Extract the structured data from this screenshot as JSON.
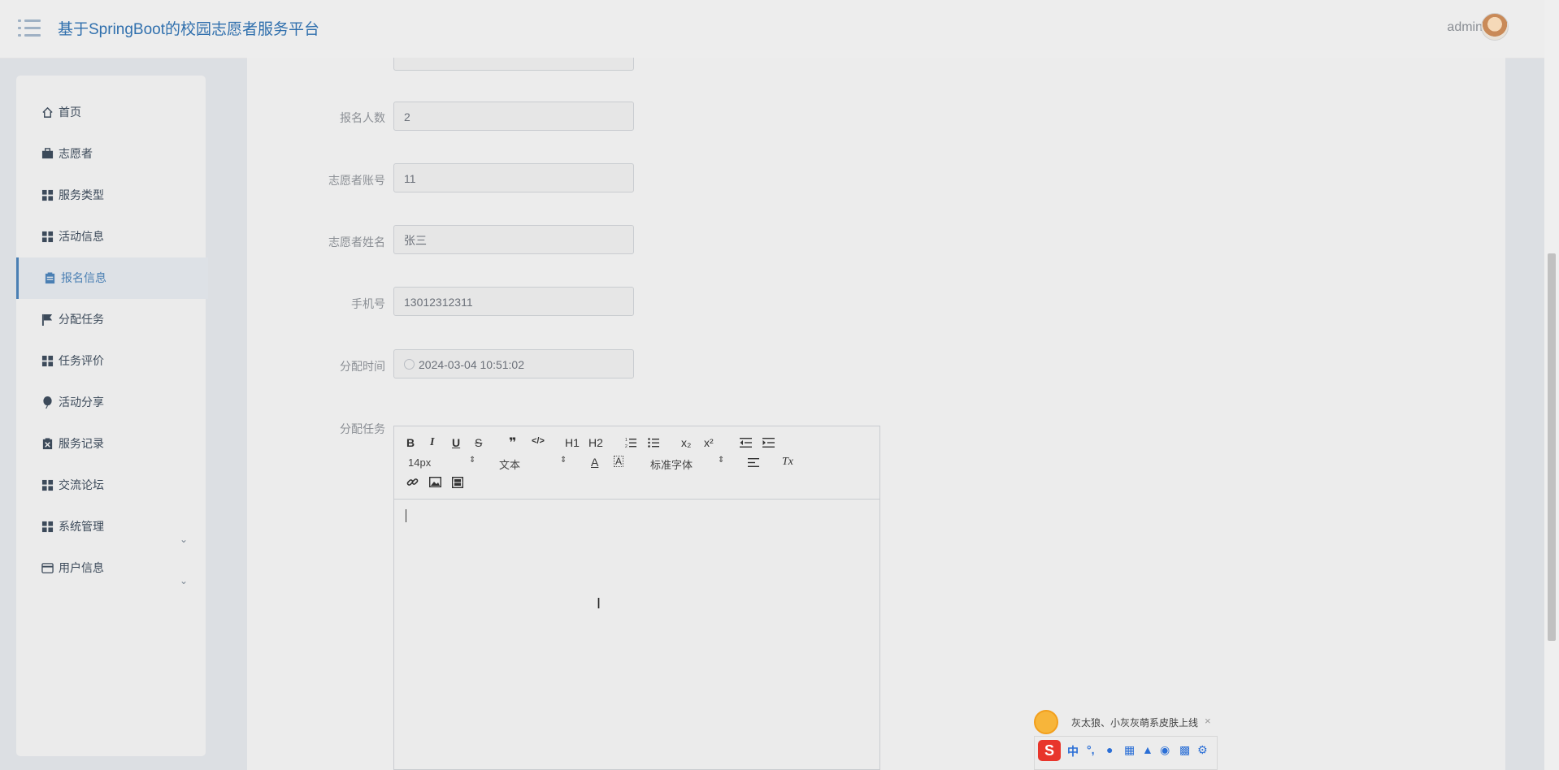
{
  "header": {
    "app_title": "基于SpringBoot的校园志愿者服务平台",
    "username": "admin"
  },
  "sidebar": {
    "items": [
      {
        "label": "首页",
        "icon": "home-icon"
      },
      {
        "label": "志愿者",
        "icon": "briefcase-icon"
      },
      {
        "label": "服务类型",
        "icon": "grid-icon"
      },
      {
        "label": "活动信息",
        "icon": "grid-icon"
      },
      {
        "label": "报名信息",
        "icon": "clipboard-icon",
        "active": true
      },
      {
        "label": "分配任务",
        "icon": "flag-icon"
      },
      {
        "label": "任务评价",
        "icon": "grid-icon"
      },
      {
        "label": "活动分享",
        "icon": "balloon-icon"
      },
      {
        "label": "服务记录",
        "icon": "clipboard-x-icon"
      },
      {
        "label": "交流论坛",
        "icon": "grid-icon"
      },
      {
        "label": "系统管理",
        "icon": "grid-icon",
        "expandable": true
      },
      {
        "label": "用户信息",
        "icon": "wallet-icon",
        "expandable": true
      }
    ]
  },
  "form": {
    "fields": [
      {
        "label": "报名人数",
        "value": "2"
      },
      {
        "label": "志愿者账号",
        "value": "11"
      },
      {
        "label": "志愿者姓名",
        "value": "张三"
      },
      {
        "label": "手机号",
        "value": "13012312311"
      },
      {
        "label": "分配时间",
        "value": "2024-03-04 10:51:02"
      }
    ],
    "editor_label": "分配任务"
  },
  "editor": {
    "font_size": "14px",
    "text_style": "文本",
    "font_family": "标准字体",
    "buttons": {
      "bold": "B",
      "italic": "I",
      "underline": "U",
      "strike": "S",
      "quote": "❞",
      "code": "</>",
      "h1": "H1",
      "h2": "H2",
      "sub": "x₂",
      "sup": "x²",
      "clear": "Tx",
      "font_color": "A",
      "bg_color": "A"
    }
  },
  "ime": {
    "tip": "灰太狼、小灰灰萌系皮肤上线",
    "close": "×",
    "logo": "S",
    "mode": "中",
    "punct": "°,"
  },
  "colors": {
    "accent": "#4a7fb3",
    "title": "#2f6fad",
    "sidebar_bg": "#ebebeb",
    "main_bg": "#ececec"
  }
}
